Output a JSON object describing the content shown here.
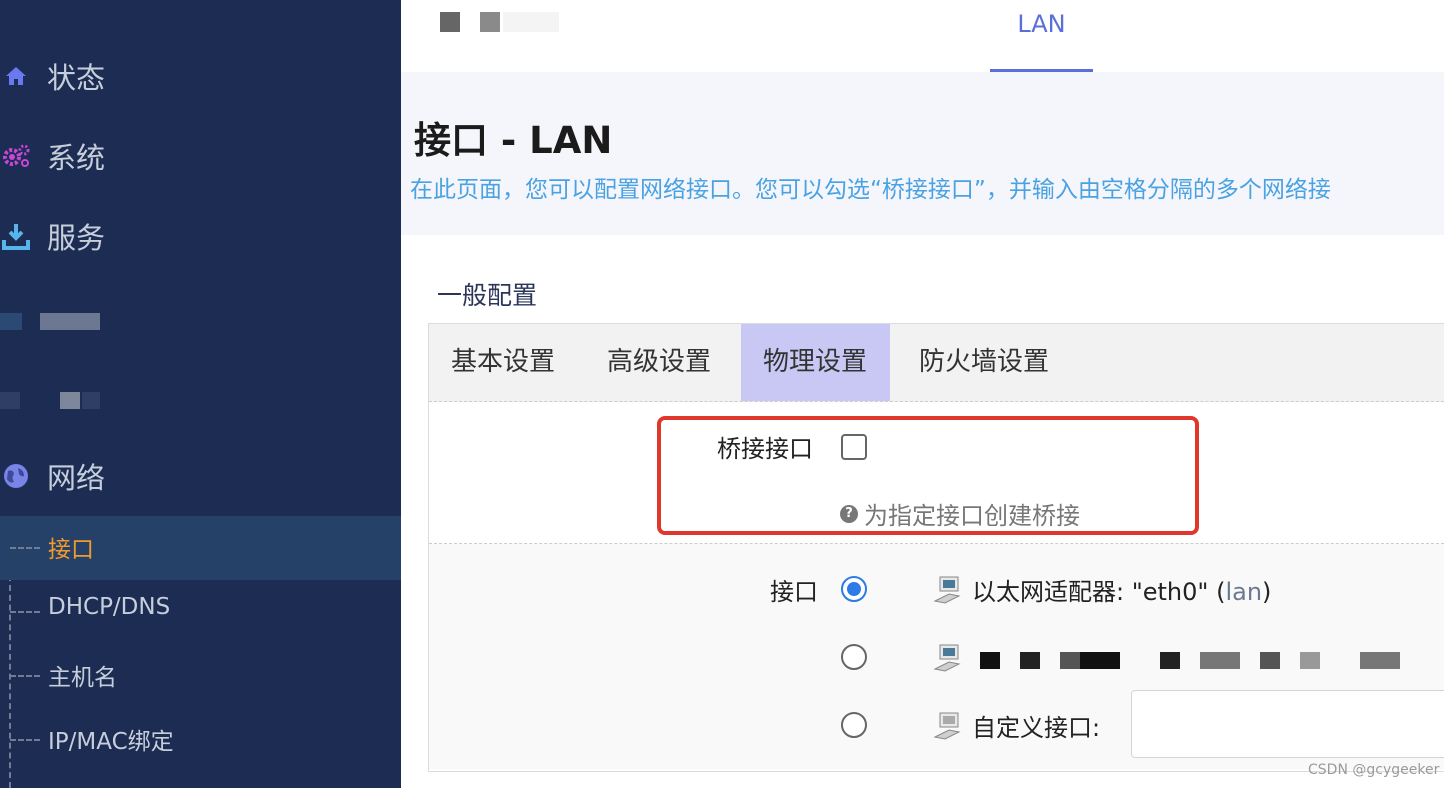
{
  "sidebar": {
    "items": [
      {
        "label": "状态",
        "icon": "home-icon",
        "color": "#6a79f0"
      },
      {
        "label": "系统",
        "icon": "gears-icon",
        "color": "#c847d8"
      },
      {
        "label": "服务",
        "icon": "download-icon",
        "color": "#5ab4ec"
      },
      {
        "label": "网络",
        "icon": "globe-icon",
        "color": "#7a83e6"
      }
    ],
    "subitems": [
      {
        "label": "接口",
        "active": true
      },
      {
        "label": "DHCP/DNS"
      },
      {
        "label": "主机名"
      },
      {
        "label": "IP/MAC绑定"
      }
    ]
  },
  "topbar": {
    "tab_lan": "LAN"
  },
  "header": {
    "title": "接口 - LAN",
    "description": "在此页面，您可以配置网络接口。您可以勾选“桥接接口”，并输入由空格分隔的多个网络接"
  },
  "section": {
    "title": "一般配置"
  },
  "tabs": [
    "基本设置",
    "高级设置",
    "物理设置",
    "防火墙设置"
  ],
  "bridge": {
    "label": "桥接接口",
    "help": "为指定接口创建桥接",
    "checked": false
  },
  "interface": {
    "label": "接口",
    "options": [
      {
        "text": "以太网适配器: \"eth0\" (",
        "tag": "lan",
        "suffix": ")",
        "checked": true
      },
      {
        "text": "",
        "checked": false
      },
      {
        "text": "自定义接口:",
        "checked": false
      }
    ]
  },
  "watermark": "CSDN @gcygeeker"
}
